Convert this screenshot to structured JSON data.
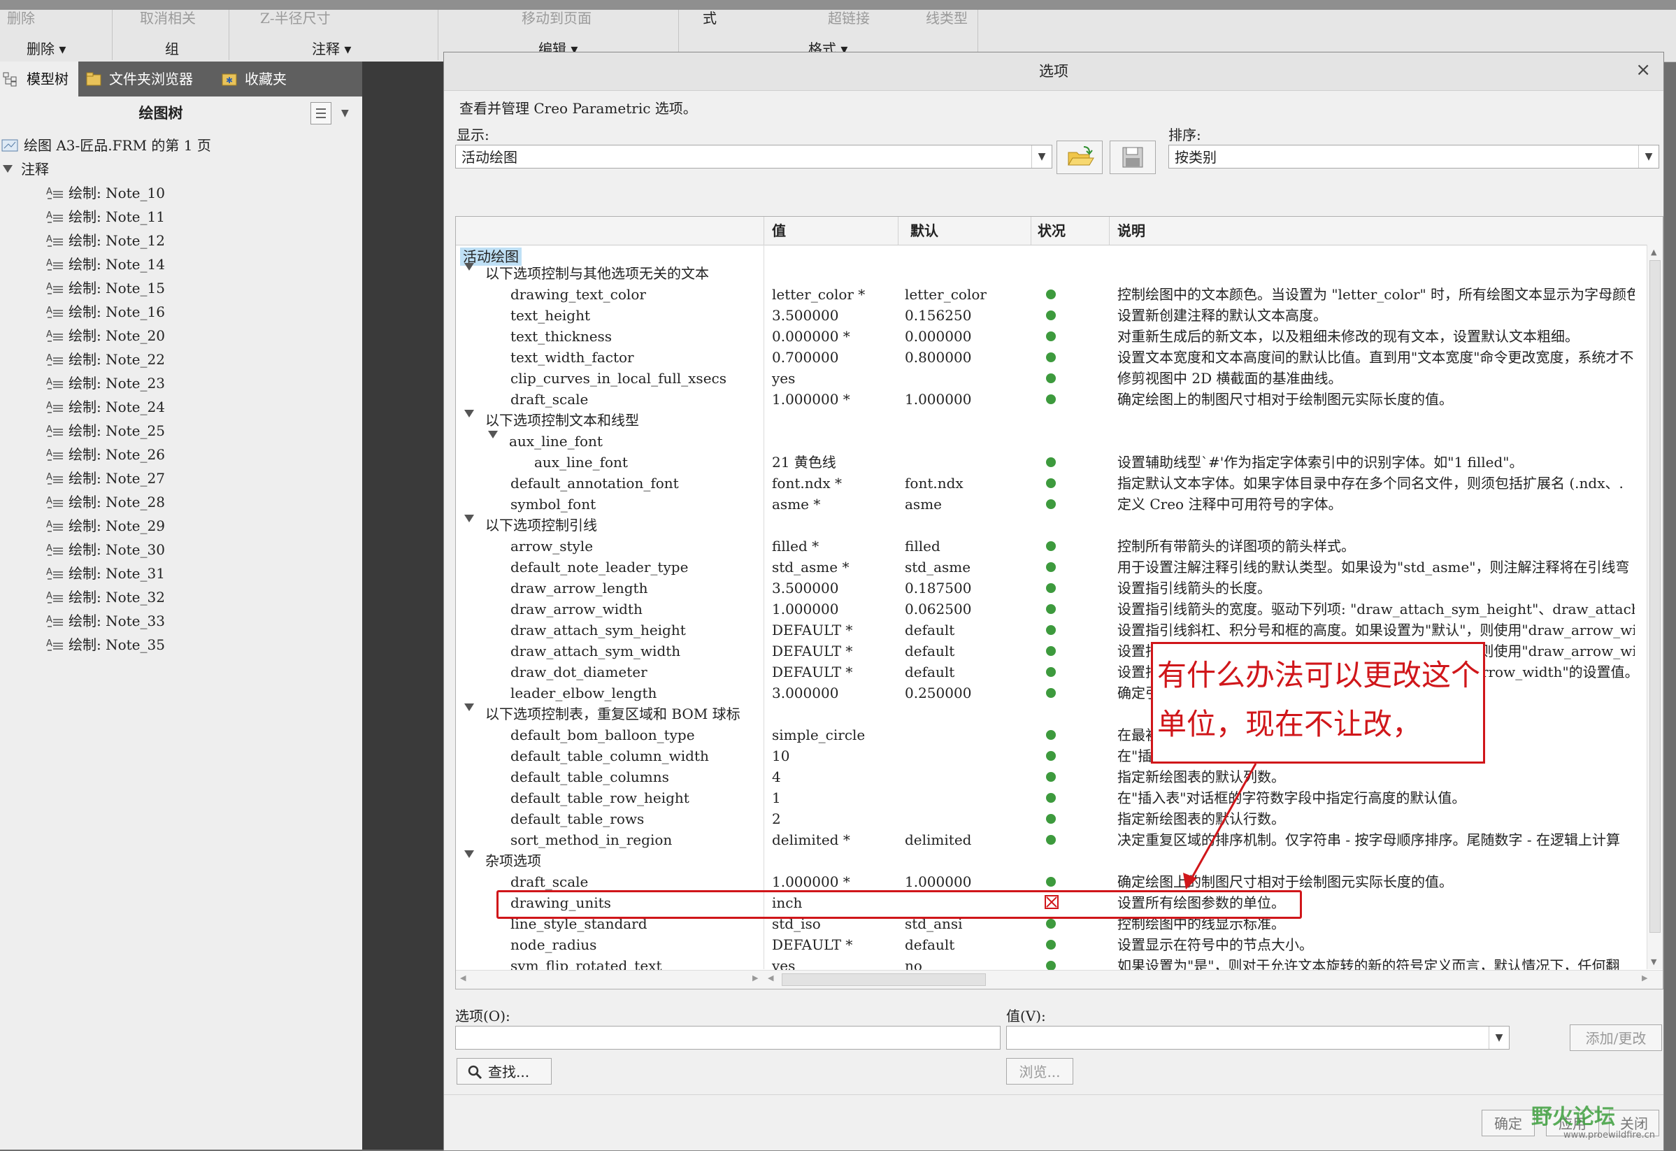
{
  "ribbon": {
    "top_items": [
      "删除",
      "取消相关",
      "Z-半径尺寸",
      "移动到页面",
      "式",
      "超链接",
      "线类型"
    ],
    "groups": [
      "删除 ▾",
      "组",
      "注释 ▾",
      "编辑 ▾",
      "格式 ▾"
    ]
  },
  "left_panel": {
    "tabs": [
      "模型树",
      "文件夹浏览器",
      "收藏夹"
    ],
    "tree_title": "绘图树",
    "root": "绘图 A3-匠品.FRM 的第 1 页",
    "section": "注释",
    "notes": [
      "绘制: Note_10",
      "绘制: Note_11",
      "绘制: Note_12",
      "绘制: Note_14",
      "绘制: Note_15",
      "绘制: Note_16",
      "绘制: Note_20",
      "绘制: Note_22",
      "绘制: Note_23",
      "绘制: Note_24",
      "绘制: Note_25",
      "绘制: Note_26",
      "绘制: Note_27",
      "绘制: Note_28",
      "绘制: Note_29",
      "绘制: Note_30",
      "绘制: Note_31",
      "绘制: Note_32",
      "绘制: Note_33",
      "绘制: Note_35"
    ]
  },
  "dialog": {
    "title": "选项",
    "close": "×",
    "intro": "查看并管理 Creo Parametric 选项。",
    "display_label": "显示:",
    "display_value": "活动绘图",
    "sort_label": "排序:",
    "sort_value": "按类别",
    "columns": [
      "值",
      "默认",
      "状况",
      "说明"
    ],
    "category_badge": "活动绘图",
    "rows": [
      {
        "kind": "group",
        "name": "以下选项控制与其他选项无关的文本"
      },
      {
        "kind": "opt",
        "name": "drawing_text_color",
        "value": "letter_color *",
        "def": "letter_color",
        "status": "ok",
        "desc": "控制绘图中的文本颜色。当设置为 \"letter_color\" 时，所有绘图文本显示为字母颜色"
      },
      {
        "kind": "opt",
        "name": "text_height",
        "value": "3.500000",
        "def": "0.156250",
        "status": "ok",
        "desc": "设置新创建注释的默认文本高度。"
      },
      {
        "kind": "opt",
        "name": "text_thickness",
        "value": "0.000000 *",
        "def": "0.000000",
        "status": "ok",
        "desc": "对重新生成后的新文本，以及粗细未修改的现有文本，设置默认文本粗细。"
      },
      {
        "kind": "opt",
        "name": "text_width_factor",
        "value": "0.700000",
        "def": "0.800000",
        "status": "ok",
        "desc": "设置文本宽度和文本高度间的默认比值。直到用\"文本宽度\"命令更改宽度，系统才不"
      },
      {
        "kind": "opt",
        "name": "clip_curves_in_local_full_xsecs",
        "value": "yes",
        "def": "",
        "status": "ok",
        "desc": "修剪视图中 2D 横截面的基准曲线。"
      },
      {
        "kind": "opt",
        "name": "draft_scale",
        "value": "1.000000 *",
        "def": "1.000000",
        "status": "ok",
        "desc": "确定绘图上的制图尺寸相对于绘制图元实际长度的值。"
      },
      {
        "kind": "group",
        "name": "以下选项控制文本和线型"
      },
      {
        "kind": "subgroup",
        "name": "aux_line_font"
      },
      {
        "kind": "opt2",
        "name": "aux_line_font",
        "value": "21 黄色线",
        "def": "",
        "status": "ok",
        "desc": "设置辅助线型`#'作为指定字体索引中的识别字体。如\"1 filled\"。"
      },
      {
        "kind": "opt",
        "name": "default_annotation_font",
        "value": "font.ndx *",
        "def": "font.ndx",
        "status": "ok",
        "desc": "指定默认文本字体。如果字体目录中存在多个同名文件，则须包括扩展名 (.ndx、."
      },
      {
        "kind": "opt",
        "name": "symbol_font",
        "value": "asme *",
        "def": "asme",
        "status": "ok",
        "desc": "定义 Creo 注释中可用符号的字体。"
      },
      {
        "kind": "group",
        "name": "以下选项控制引线"
      },
      {
        "kind": "opt",
        "name": "arrow_style",
        "value": "filled *",
        "def": "filled",
        "status": "ok",
        "desc": "控制所有带箭头的详图项的箭头样式。"
      },
      {
        "kind": "opt",
        "name": "default_note_leader_type",
        "value": "std_asme *",
        "def": "std_asme",
        "status": "ok",
        "desc": "用于设置注解注释引线的默认类型。如果设为\"std_asme\"，则注解注释将在引线弯"
      },
      {
        "kind": "opt",
        "name": "draw_arrow_length",
        "value": "3.500000",
        "def": "0.187500",
        "status": "ok",
        "desc": "设置指引线箭头的长度。"
      },
      {
        "kind": "opt",
        "name": "draw_arrow_width",
        "value": "1.000000",
        "def": "0.062500",
        "status": "ok",
        "desc": "设置指引线箭头的宽度。驱动下列项: \"draw_attach_sym_height\"、draw_attach"
      },
      {
        "kind": "opt",
        "name": "draw_attach_sym_height",
        "value": "DEFAULT *",
        "def": "default",
        "status": "ok",
        "desc": "设置指引线斜杠、积分号和框的高度。如果设置为\"默认\"，则使用\"draw_arrow_wi"
      },
      {
        "kind": "opt",
        "name": "draw_attach_sym_width",
        "value": "DEFAULT *",
        "def": "default",
        "status": "ok",
        "desc": "设置指引线斜杠、积分号和框的宽度。如果设置为\"默认\"，则使用\"draw_arrow_wi"
      },
      {
        "kind": "opt",
        "name": "draw_dot_diameter",
        "value": "DEFAULT *",
        "def": "default",
        "status": "ok",
        "desc": "设置指引线点的直径。如果设置为\"默认\"，则使用\"draw_arrow_width\"的设置值。"
      },
      {
        "kind": "opt",
        "name": "leader_elbow_length",
        "value": "3.000000",
        "def": "0.250000",
        "status": "ok",
        "desc": "确定引线肘节的长度。"
      },
      {
        "kind": "group",
        "name": "以下选项控制表，重复区域和 BOM 球标"
      },
      {
        "kind": "opt",
        "name": "default_bom_balloon_type",
        "value": "simple_circle",
        "def": "",
        "status": "ok",
        "desc": "在最初创建时，从\"BOM 球标\"按钮从磁盘中选择自定"
      },
      {
        "kind": "opt",
        "name": "default_table_column_width",
        "value": "10",
        "def": "",
        "status": "ok",
        "desc": "在\"插入表\"对话框中指定列宽度的默认值。"
      },
      {
        "kind": "opt",
        "name": "default_table_columns",
        "value": "4",
        "def": "",
        "status": "ok",
        "desc": "指定新绘图表的默认列数。"
      },
      {
        "kind": "opt",
        "name": "default_table_row_height",
        "value": "1",
        "def": "",
        "status": "ok",
        "desc": "在\"插入表\"对话框的字符数字段中指定行高度的默认值。"
      },
      {
        "kind": "opt",
        "name": "default_table_rows",
        "value": "2",
        "def": "",
        "status": "ok",
        "desc": "指定新绘图表的默认行数。"
      },
      {
        "kind": "opt",
        "name": "sort_method_in_region",
        "value": "delimited *",
        "def": "delimited",
        "status": "ok",
        "desc": "决定重复区域的排序机制。仅字符串 - 按字母顺序排序。尾随数字 - 在逻辑上计算"
      },
      {
        "kind": "group",
        "name": "杂项选项"
      },
      {
        "kind": "opt",
        "name": "draft_scale",
        "value": "1.000000 *",
        "def": "1.000000",
        "status": "ok",
        "desc": "确定绘图上的制图尺寸相对于绘制图元实际长度的值。"
      },
      {
        "kind": "opt",
        "name": "drawing_units",
        "value": "inch",
        "def": "",
        "status": "locked",
        "desc": "设置所有绘图参数的单位。"
      },
      {
        "kind": "opt",
        "name": "line_style_standard",
        "value": "std_iso",
        "def": "std_ansi",
        "status": "ok",
        "desc": "控制绘图中的线显示标准。"
      },
      {
        "kind": "opt",
        "name": "node_radius",
        "value": "DEFAULT *",
        "def": "default",
        "status": "ok",
        "desc": "设置显示在符号中的节点大小。"
      },
      {
        "kind": "opt",
        "name": "sym_flip_rotated_text",
        "value": "yes",
        "def": "no",
        "status": "ok",
        "desc": "如果设置为\"是\"，则对于允许文本旋转的新的符号定义而言，默认情况下，任何翻"
      }
    ],
    "option_label": "选项(O):",
    "value_label": "值(V):",
    "find_button": "查找...",
    "browse_button": "浏览...",
    "add_button": "添加/更改",
    "ok_button": "确定",
    "apply_button": "应用",
    "close_button": "关闭"
  },
  "annotation": {
    "text": "有什么办法可以更改这个单位，现在不让改，",
    "color": "#d0161a"
  },
  "watermark": {
    "text": "野火论坛",
    "sub": "www.proewildfire.cn"
  },
  "colors": {
    "ok_dot": "#3d9a3d",
    "highlight": "#d0161a",
    "category": "#bfe0f5"
  }
}
